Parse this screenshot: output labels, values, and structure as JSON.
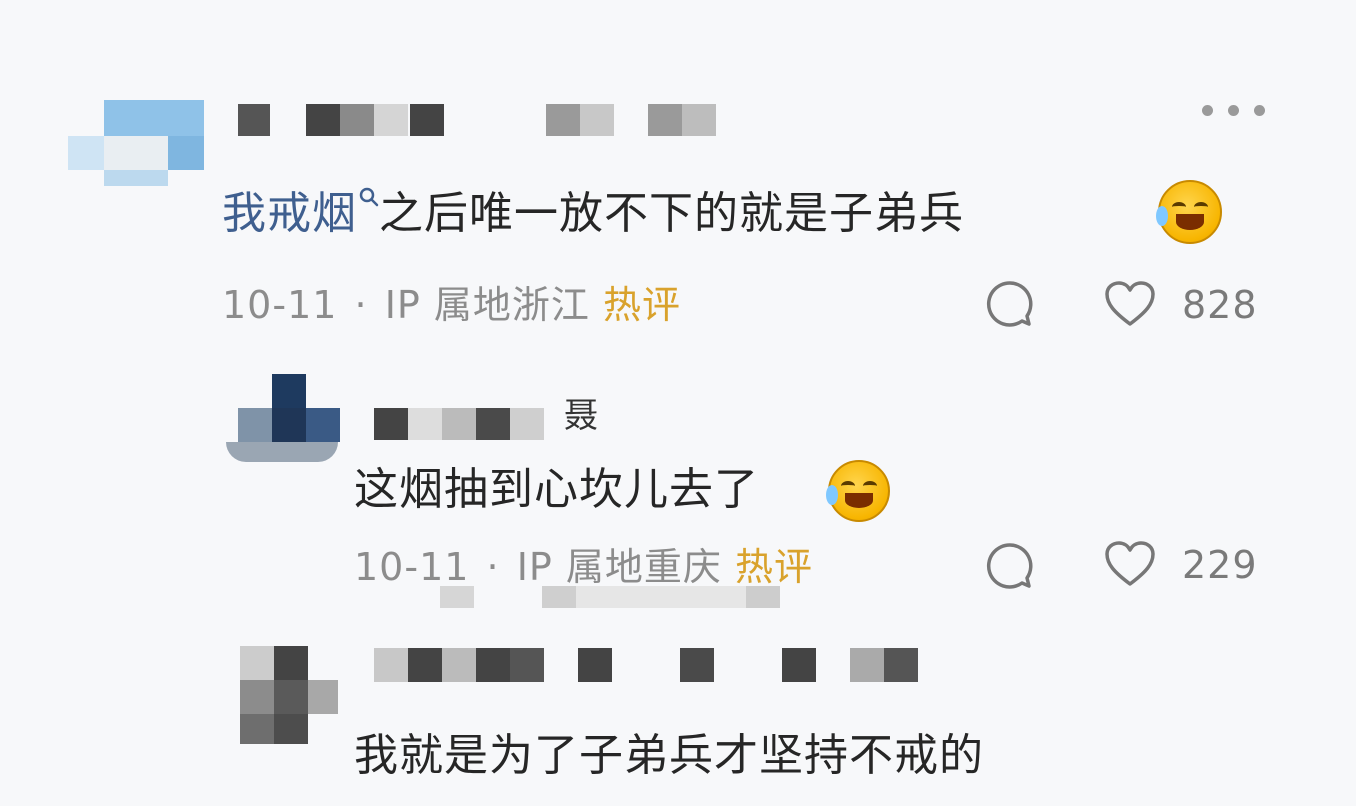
{
  "comments": [
    {
      "text_linked": "我戒烟",
      "text_rest": "之后唯一放不下的就是子弟兵",
      "date": "10-11",
      "separator": "·",
      "ip_location": "IP 属地浙江",
      "hot_label": "热评",
      "likes": "828"
    },
    {
      "username_glyph": "聂",
      "text": "这烟抽到心坎儿去了",
      "date": "10-11",
      "separator": "·",
      "ip_location": "IP 属地重庆",
      "hot_label": "热评",
      "likes": "229"
    },
    {
      "text": "我就是为了子弟兵才坚持不戒的"
    }
  ],
  "icons": {
    "more": "more-dots-icon",
    "search": "search-icon",
    "reply": "comment-bubble-icon",
    "like": "heart-icon",
    "emoji": "laugh-cry-emoji"
  },
  "colors": {
    "hot": "#d9a22c",
    "link": "#3f5f8f",
    "text": "#262626",
    "meta": "#8c8c8c"
  }
}
